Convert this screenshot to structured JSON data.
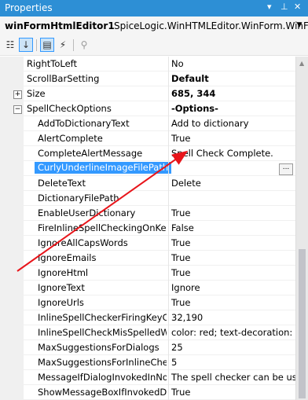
{
  "title": "Properties",
  "title_icons": [
    "dropdown-icon",
    "pin-icon",
    "close-icon"
  ],
  "object": {
    "name": "winFormHtmlEditor1",
    "type": "SpiceLogic.WinHTMLEditor.WinForm.WinFo"
  },
  "toolbar": [
    "categorized-icon",
    "alphabetical-icon",
    "properties-icon",
    "events-icon",
    "property-pages-icon"
  ],
  "rows": [
    {
      "name": "RightToLeft",
      "value": "No",
      "indent": 0
    },
    {
      "name": "ScrollBarSetting",
      "value": "Default",
      "indent": 0,
      "bold": true
    },
    {
      "name": "Size",
      "value": "685, 344",
      "indent": 0,
      "bold": true,
      "expander": "+"
    },
    {
      "name": "SpellCheckOptions",
      "value": "-Options-",
      "indent": 0,
      "bold": true,
      "expander": "−"
    },
    {
      "name": "AddToDictionaryText",
      "value": "Add to dictionary",
      "indent": 1
    },
    {
      "name": "AlertComplete",
      "value": "True",
      "indent": 1
    },
    {
      "name": "CompleteAlertMessage",
      "value": "Spell Check Complete.",
      "indent": 1
    },
    {
      "name": "CurlyUnderlineImageFilePath",
      "value": "",
      "indent": 1,
      "selected": true,
      "ellipsis": "..."
    },
    {
      "name": "DeleteText",
      "value": "Delete",
      "indent": 1
    },
    {
      "name": "DictionaryFilePath",
      "value": "",
      "indent": 1
    },
    {
      "name": "EnableUserDictionary",
      "value": "True",
      "indent": 1
    },
    {
      "name": "FireInlineSpellCheckingOnKeyS",
      "value": "False",
      "indent": 1
    },
    {
      "name": "IgnoreAllCapsWords",
      "value": "True",
      "indent": 1
    },
    {
      "name": "IgnoreEmails",
      "value": "True",
      "indent": 1
    },
    {
      "name": "IgnoreHtml",
      "value": "True",
      "indent": 1
    },
    {
      "name": "IgnoreText",
      "value": "Ignore",
      "indent": 1
    },
    {
      "name": "IgnoreUrls",
      "value": "True",
      "indent": 1
    },
    {
      "name": "InlineSpellCheckerFiringKeyCoc",
      "value": "32,190",
      "indent": 1
    },
    {
      "name": "InlineSpellCheckMisSpelledWor",
      "value": "color: red; text-decoration: un",
      "indent": 1
    },
    {
      "name": "MaxSuggestionsForDialogs",
      "value": "25",
      "indent": 1
    },
    {
      "name": "MaxSuggestionsForInlineCheck",
      "value": "5",
      "indent": 1
    },
    {
      "name": "MessageIfDialogInvokedInNonV",
      "value": "The spell checker can be used",
      "indent": 1
    },
    {
      "name": "ShowMessageBoxIfInvokedDialo",
      "value": "True",
      "indent": 1
    }
  ],
  "colors": {
    "titlebar": "#2d8fd5",
    "selection": "#3399ff",
    "annotation_arrow": "#e8151b"
  }
}
